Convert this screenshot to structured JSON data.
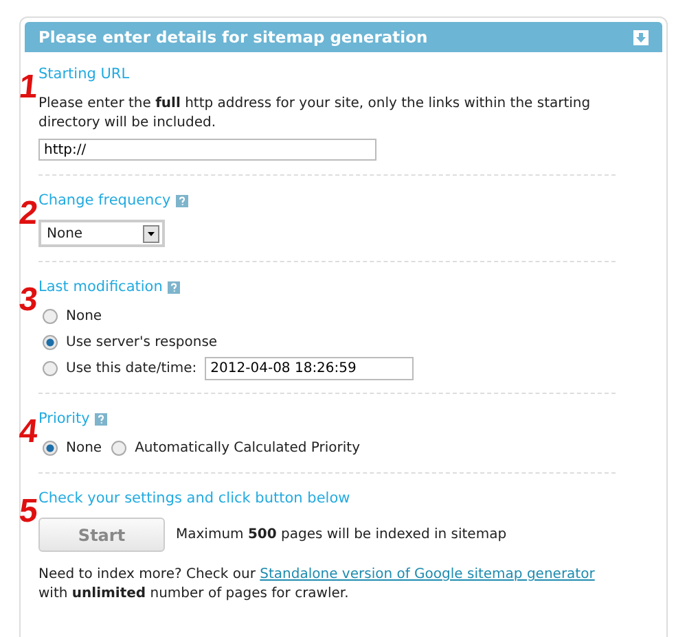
{
  "panel": {
    "title": "Please enter details for sitemap generation"
  },
  "sections": [
    {
      "kind": "url",
      "marker": "1",
      "heading": "Starting URL",
      "help": false,
      "description": "Please enter the **full** http address for your site, only the links within the starting directory will be included.",
      "value": "http://"
    },
    {
      "kind": "select",
      "marker": "2",
      "heading": "Change frequency",
      "help": true,
      "value": "None"
    },
    {
      "kind": "radios",
      "marker": "3",
      "heading": "Last modification",
      "help": true,
      "inline": false,
      "options": [
        {
          "label": "None",
          "selected": false
        },
        {
          "label": "Use server's response",
          "selected": true
        },
        {
          "label": "Use this date/time:",
          "selected": false,
          "value": "2012-04-08 18:26:59"
        }
      ]
    },
    {
      "kind": "radios",
      "marker": "4",
      "heading": "Priority",
      "help": true,
      "inline": true,
      "options": [
        {
          "label": "None",
          "selected": true
        },
        {
          "label": "Automatically Calculated Priority",
          "selected": false
        }
      ]
    },
    {
      "kind": "submit",
      "marker": "5",
      "heading": "Check your settings and click button below",
      "help": false,
      "button": "Start",
      "note": "Maximum **500** pages will be indexed in sitemap",
      "more_before": "Need to index more? Check our",
      "link": "Standalone version of Google sitemap generator",
      "more_after": "with **unlimited** number of pages for crawler."
    }
  ]
}
